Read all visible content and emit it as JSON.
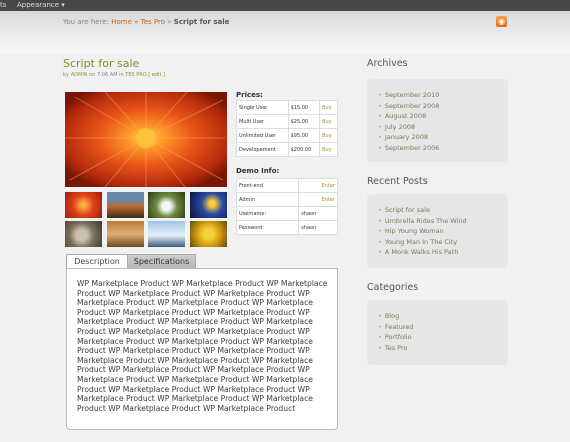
{
  "adminbar": {
    "left_label": "ts",
    "menu_label": "Appearance ▾"
  },
  "breadcrumb": {
    "prefix": "You are here:",
    "home": "Home",
    "sep1": "»",
    "section": "Tes Pro",
    "sep2": "»",
    "current": "Script for sale"
  },
  "post": {
    "title": "Script for sale",
    "meta_by": "by",
    "meta_author": "ADMIN",
    "meta_on": "on 7:06 AM in",
    "meta_cat": "TES PRO",
    "meta_edit": "[ edit ]"
  },
  "prices": {
    "heading": "Prices:",
    "rows": [
      {
        "name": "Single User",
        "price": "$15.00",
        "action": "Buy"
      },
      {
        "name": "Multi User",
        "price": "$25.00",
        "action": "Buy"
      },
      {
        "name": "Unlimited User",
        "price": "$95.00",
        "action": "Buy"
      },
      {
        "name": "Developement",
        "price": "$200.00",
        "action": "Buy"
      }
    ]
  },
  "demo": {
    "heading": "Demo Info:",
    "rows": [
      {
        "label": "Front-end",
        "value": "Enter"
      },
      {
        "label": "Admin",
        "value": "Enter"
      },
      {
        "label": "Username:",
        "value": "shaon"
      },
      {
        "label": "Password:",
        "value": "shaon"
      }
    ]
  },
  "tabs": {
    "description": "Description",
    "specifications": "Specifications"
  },
  "description_text": "WP Marketplace Product WP Marketplace Product WP Marketplace Product WP Marketplace Product WP Marketplace Product WP Marketplace Product WP Marketplace Product WP Marketplace Product WP Marketplace Product WP Marketplace Product WP Marketplace Product WP Marketplace Product WP Marketplace Product WP Marketplace Product WP Marketplace Product WP Marketplace Product WP Marketplace Product WP Marketplace Product WP Marketplace Product WP Marketplace Product WP Marketplace Product WP Marketplace Product WP Marketplace Product WP Marketplace Product WP Marketplace Product WP Marketplace Product WP Marketplace Product WP Marketplace Product WP Marketplace Product WP Marketplace Product WP Marketplace Product WP Marketplace Product WP Marketplace Product WP Marketplace Product WP Marketplace Product",
  "sidebar": {
    "archives": {
      "title": "Archives",
      "items": [
        "September 2010",
        "September 2008",
        "August 2008",
        "July 2008",
        "January 2008",
        "September 2006"
      ]
    },
    "recent": {
      "title": "Recent Posts",
      "items": [
        "Script for sale",
        "Umbrella Rides The Wind",
        "Hip Young Woman",
        "Young Man In The City",
        "A Monk Walks His Path"
      ]
    },
    "categories": {
      "title": "Categories",
      "items": [
        "Blog",
        "Featured",
        "Portfolio",
        "Tes Pro"
      ]
    }
  },
  "colors": {
    "link": "#c5671a",
    "title": "#8a8a2a",
    "buy": "#b08a2a"
  },
  "icons": {
    "rss": "rss-feed-icon",
    "bullet": "bullet-icon"
  }
}
